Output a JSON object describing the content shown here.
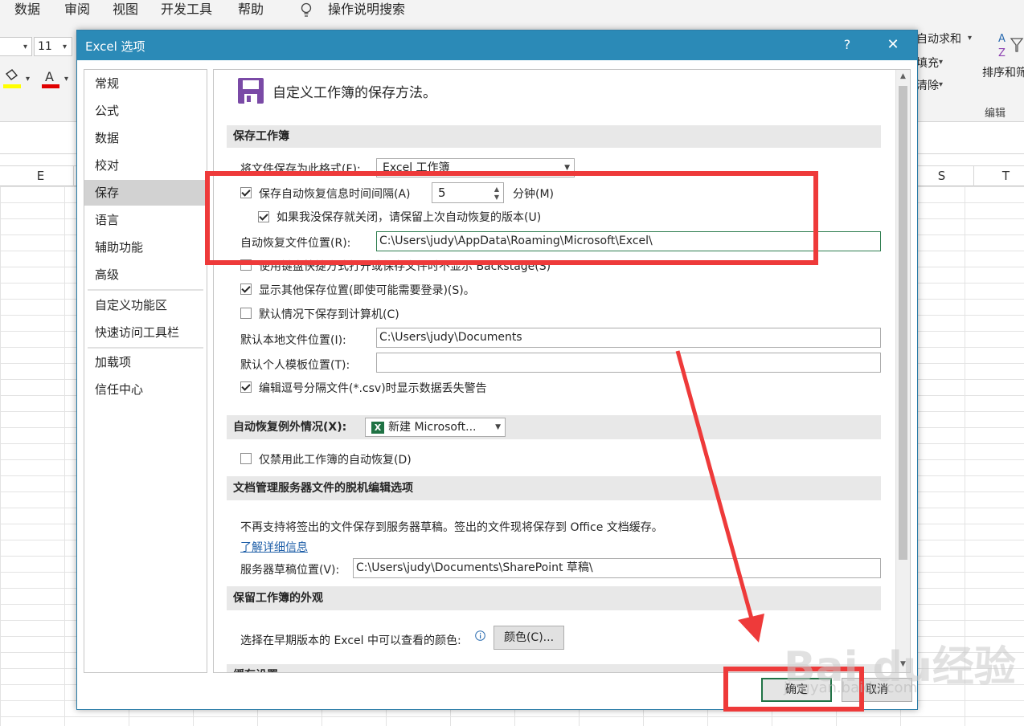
{
  "excel": {
    "menu": [
      "数据",
      "审阅",
      "视图",
      "开发工具",
      "帮助"
    ],
    "search_label": "操作说明搜索",
    "font_size": "11",
    "ribbon_right": {
      "autosum": "自动求和",
      "fill": "填充",
      "clear": "清除",
      "sort": "排序和筛选",
      "group_label": "编辑"
    },
    "columns": {
      "e": "E",
      "s": "S",
      "t": "T"
    }
  },
  "dialog": {
    "title": "Excel 选项",
    "help_label": "?",
    "close_label": "✕",
    "nav": [
      "常规",
      "公式",
      "数据",
      "校对",
      "保存",
      "语言",
      "辅助功能",
      "高级",
      "自定义功能区",
      "快速访问工具栏",
      "加载项",
      "信任中心"
    ],
    "selected_nav": "保存",
    "header": "自定义工作簿的保存方法。",
    "save_section": {
      "title": "保存工作簿",
      "format_label": "将文件保存为此格式(F):",
      "format_value": "Excel 工作簿",
      "autorecover_label": "保存自动恢复信息时间间隔(A)",
      "autorecover_checked": true,
      "interval_value": "5",
      "minutes_label": "分钟(M)",
      "keep_last_label": "如果我没保存就关闭，请保留上次自动恢复的版本(U)",
      "keep_last_checked": true,
      "autorecover_location_label": "自动恢复文件位置(R):",
      "autorecover_location_value": "C:\\Users\\judy\\AppData\\Roaming\\Microsoft\\Excel\\",
      "no_backstage_label": "使用键盘快捷方式打开或保存文件时不显示 Backstage(S)",
      "no_backstage_checked": false,
      "show_other_label": "显示其他保存位置(即使可能需要登录)(S)。",
      "show_other_checked": true,
      "default_computer_label": "默认情况下保存到计算机(C)",
      "default_computer_checked": false,
      "default_local_label": "默认本地文件位置(I):",
      "default_local_value": "C:\\Users\\judy\\Documents",
      "template_label": "默认个人模板位置(T):",
      "template_value": "",
      "csv_warning_label": "编辑逗号分隔文件(*.csv)时显示数据丢失警告",
      "csv_warning_checked": true
    },
    "exceptions_section": {
      "title": "自动恢复例外情况(X):",
      "workbook_value": "新建 Microsoft...",
      "disable_label": "仅禁用此工作簿的自动恢复(D)",
      "disable_checked": false
    },
    "server_section": {
      "title": "文档管理服务器文件的脱机编辑选项",
      "info_text": "不再支持将签出的文件保存到服务器草稿。签出的文件现将保存到 Office 文档缓存。",
      "learn_more": "了解详细信息",
      "drafts_label": "服务器草稿位置(V):",
      "drafts_value": "C:\\Users\\judy\\Documents\\SharePoint 草稿\\"
    },
    "appearance_section": {
      "title": "保留工作簿的外观",
      "colors_label": "选择在早期版本的 Excel 中可以查看的颜色:",
      "colors_button": "颜色(C)...",
      "next_title": "缓存设置"
    },
    "ok_button": "确定",
    "cancel_button": "取消"
  },
  "watermark": {
    "text": "Bai du经验",
    "sub": "jingyan.baidu.com"
  },
  "colors": {
    "accent": "#2b8ab7",
    "annotation": "#ee3a3a",
    "excel_green": "#217346",
    "nav_selected": "#d2d2d2"
  }
}
